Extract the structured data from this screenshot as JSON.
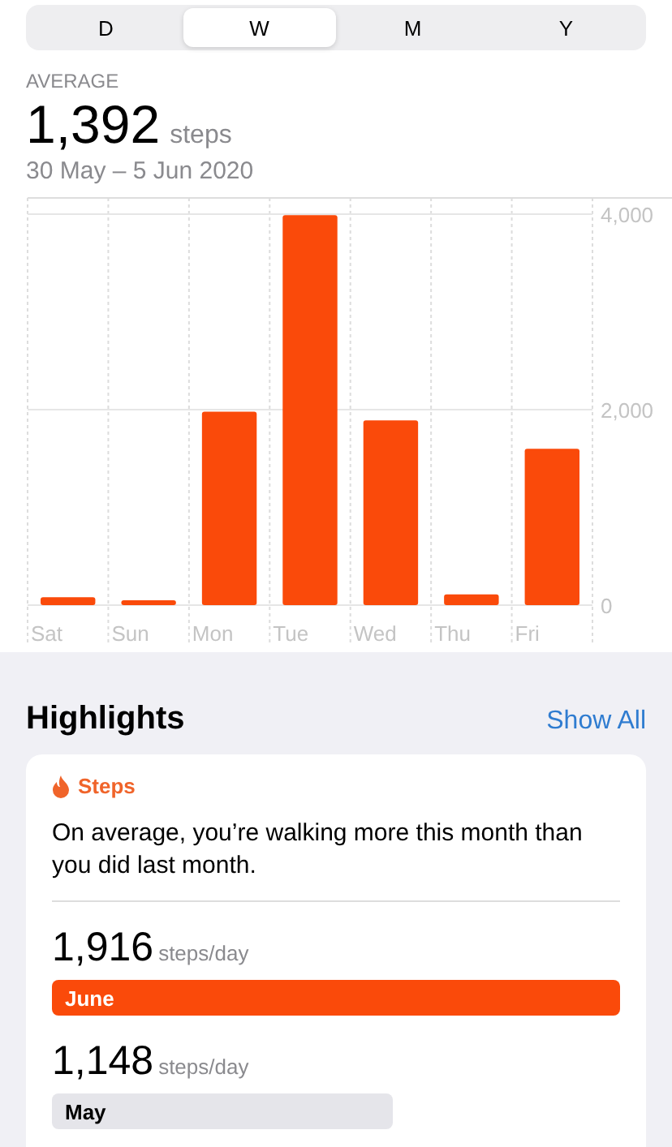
{
  "segments": [
    {
      "label": "D",
      "selected": false
    },
    {
      "label": "W",
      "selected": true
    },
    {
      "label": "M",
      "selected": false
    },
    {
      "label": "Y",
      "selected": false
    }
  ],
  "summary": {
    "label": "AVERAGE",
    "value": "1,392",
    "unit": "steps",
    "range": "30 May – 5 Jun 2020"
  },
  "chart_data": {
    "type": "bar",
    "categories": [
      "Sat",
      "Sun",
      "Mon",
      "Tue",
      "Wed",
      "Thu",
      "Fri"
    ],
    "series": [
      {
        "color": "#fa4a0a",
        "values": [
          80,
          50,
          1980,
          3990,
          1890,
          110,
          1600
        ]
      }
    ],
    "ylim": [
      0,
      4000
    ],
    "yticks": [
      {
        "value": 0,
        "label": "0"
      },
      {
        "value": 2000,
        "label": "2,000"
      },
      {
        "value": 4000,
        "label": "4,000"
      }
    ]
  },
  "highlights": {
    "title": "Highlights",
    "show_all": "Show All",
    "card": {
      "category": "Steps",
      "text": "On average, you’re walking more this month than you did last month.",
      "comparisons": [
        {
          "value": "1,916",
          "unit": "steps/day",
          "month": "June",
          "current": true
        },
        {
          "value": "1,148",
          "unit": "steps/day",
          "month": "May",
          "current": false
        }
      ]
    }
  }
}
